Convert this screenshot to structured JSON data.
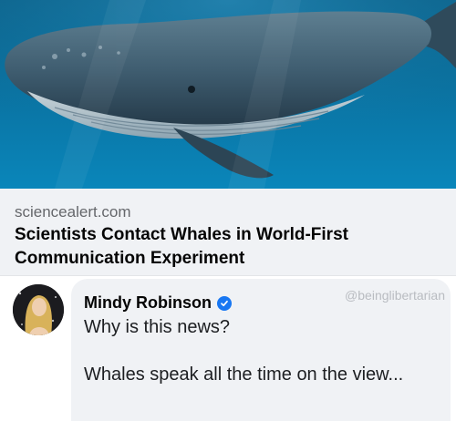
{
  "link_preview": {
    "image_alt": "Humpback whale swimming underwater",
    "domain": "sciencealert.com",
    "headline": "Scientists Contact Whales in World-First Communication Experiment"
  },
  "comment": {
    "author": "Mindy Robinson",
    "verified": true,
    "watermark": "@beinglibertarian",
    "text": "Why is this news?\n\nWhales speak all the time on the view..."
  },
  "colors": {
    "card_background": "#f0f2f5",
    "verified_badge": "#1877f2",
    "ocean": "#0a79aa"
  }
}
